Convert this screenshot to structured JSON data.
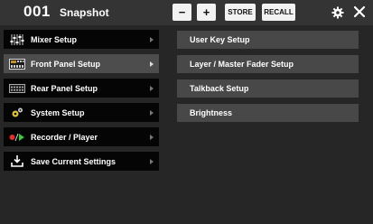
{
  "header": {
    "snapshot_number": "001",
    "title": "Snapshot",
    "minus_label": "−",
    "plus_label": "+",
    "store_label": "STORE",
    "recall_label": "RECALL",
    "settings_icon": "gear-icon",
    "close_icon": "close-icon"
  },
  "menu": {
    "items": [
      {
        "label": "Mixer Setup",
        "icon": "mixer-faders-icon"
      },
      {
        "label": "Front Panel Setup",
        "icon": "front-panel-icon"
      },
      {
        "label": "Rear Panel Setup",
        "icon": "rear-panel-icon"
      },
      {
        "label": "System Setup",
        "icon": "gears-icon"
      },
      {
        "label": "Recorder / Player",
        "icon": "record-play-icon"
      },
      {
        "label": "Save Current Settings",
        "icon": "save-download-icon"
      }
    ],
    "active_index": 1
  },
  "submenu": {
    "items": [
      {
        "label": "User Key Setup"
      },
      {
        "label": "Layer / Master Fader Setup"
      },
      {
        "label": "Talkback Setup"
      },
      {
        "label": "Brightness"
      }
    ]
  },
  "colors": {
    "background": "#262626",
    "header": "#343434",
    "menu_item": "#050505",
    "menu_item_active": "#4d4d4d",
    "submenu_item": "#484848",
    "record_red": "#e03030",
    "play_green": "#3cc83c"
  }
}
